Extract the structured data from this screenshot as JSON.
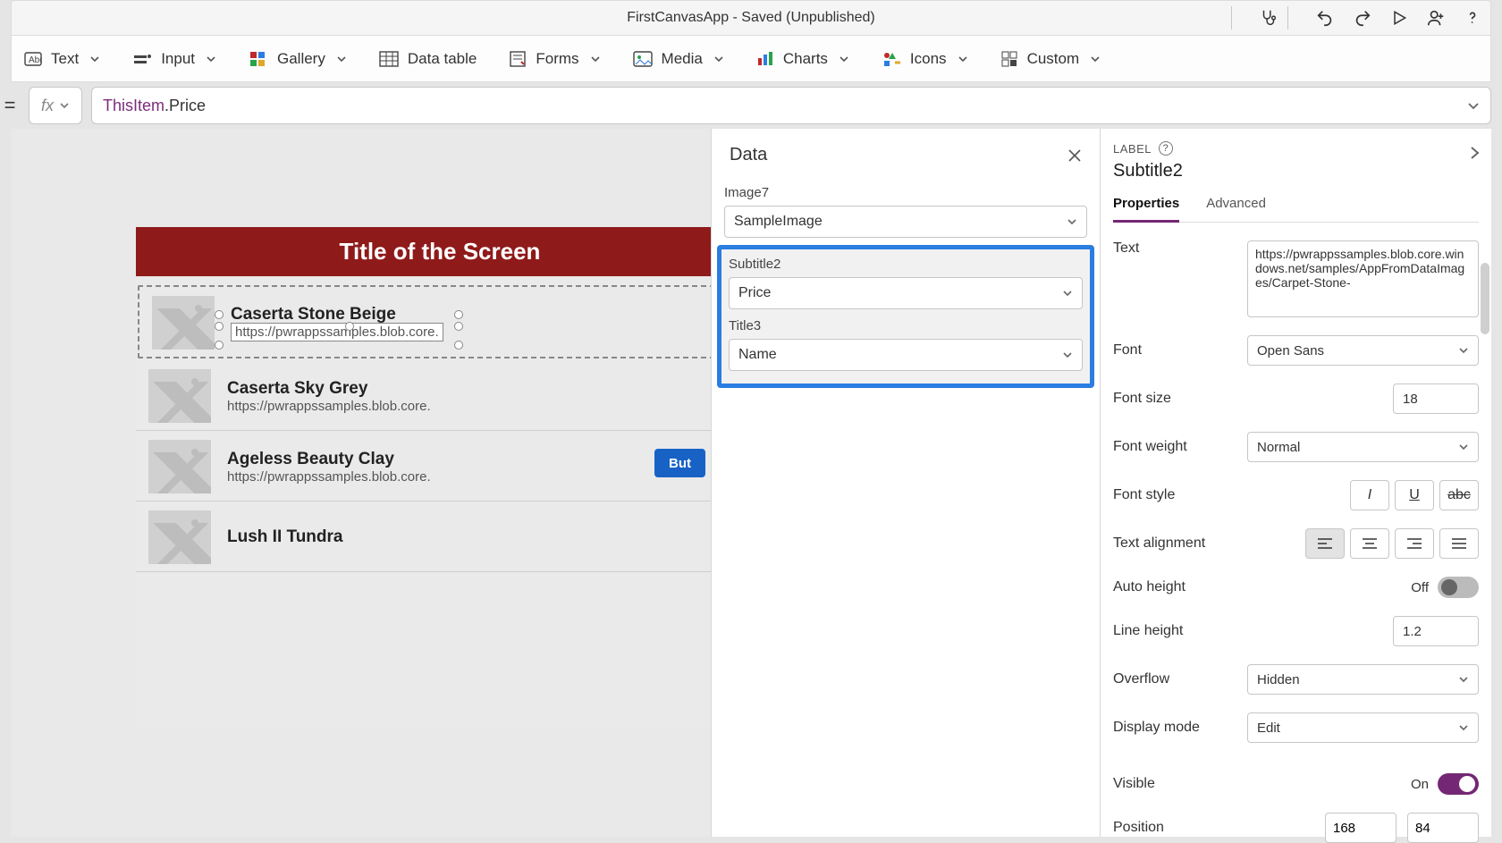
{
  "titlebar": {
    "title": "FirstCanvasApp - Saved (Unpublished)"
  },
  "ribbon": [
    {
      "label": "Text"
    },
    {
      "label": "Input"
    },
    {
      "label": "Gallery"
    },
    {
      "label": "Data table"
    },
    {
      "label": "Forms"
    },
    {
      "label": "Media"
    },
    {
      "label": "Charts"
    },
    {
      "label": "Icons"
    },
    {
      "label": "Custom"
    }
  ],
  "formula": {
    "this": "ThisItem",
    "prop": ".Price"
  },
  "canvas": {
    "screenTitle": "Title of the Screen",
    "button": "But",
    "items": [
      {
        "title": "Caserta Stone Beige",
        "sub": "https://pwrappssamples.blob.core."
      },
      {
        "title": "Caserta Sky Grey",
        "sub": "https://pwrappssamples.blob.core."
      },
      {
        "title": "Ageless Beauty Clay",
        "sub": "https://pwrappssamples.blob.core."
      },
      {
        "title": "Lush II Tundra",
        "sub": ""
      }
    ]
  },
  "dataPanel": {
    "heading": "Data",
    "image": {
      "label": "Image7",
      "value": "SampleImage"
    },
    "subtitle": {
      "label": "Subtitle2",
      "value": "Price"
    },
    "title3": {
      "label": "Title3",
      "value": "Name"
    }
  },
  "props": {
    "kind": "LABEL",
    "name": "Subtitle2",
    "tabs": {
      "properties": "Properties",
      "advanced": "Advanced"
    },
    "text": "https://pwrappssamples.blob.core.windows.net/samples/AppFromDataImages/Carpet-Stone-",
    "font": "Open Sans",
    "fontSize": "18",
    "fontWeight": "Normal",
    "autoHeight": "Off",
    "lineHeight": "1.2",
    "overflow": "Hidden",
    "displayMode": "Edit",
    "visible": "On",
    "posX": "168",
    "posY": "84",
    "labels": {
      "text": "Text",
      "font": "Font",
      "fontSize": "Font size",
      "fontWeight": "Font weight",
      "fontStyle": "Font style",
      "align": "Text alignment",
      "autoHeight": "Auto height",
      "lineHeight": "Line height",
      "overflow": "Overflow",
      "displayMode": "Display mode",
      "visible": "Visible",
      "position": "Position"
    }
  }
}
